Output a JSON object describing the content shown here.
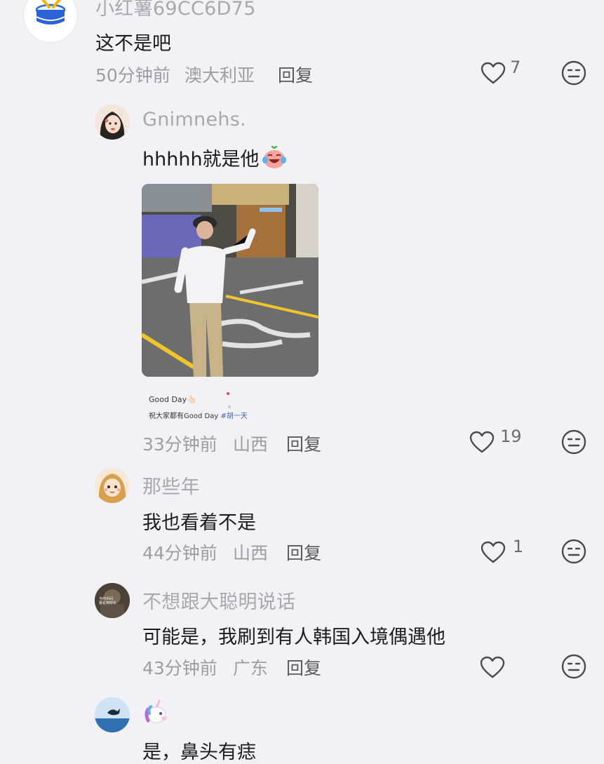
{
  "colors": {
    "background": "#f2f1f6",
    "meta_text": "#9d9da2",
    "name_text": "#a8a8ad",
    "hashtag": "#3c5fb1"
  },
  "comments": [
    {
      "username": "小红薯69CC6D75",
      "text": "这不是吧",
      "time": "50分钟前",
      "location": "澳大利亚",
      "reply_label": "回复",
      "likes": "7",
      "avatar_icon": "drum-avatar-icon"
    },
    {
      "username": "Gnimnehs.",
      "text": "hhhhh就是他",
      "emoji_icon": "laughing-tears-face-icon",
      "time": "33分钟前",
      "location": "山西",
      "reply_label": "回复",
      "likes": "19",
      "avatar_icon": "girl-portrait-avatar",
      "attachment": {
        "description_icon": "street-photo-man-in-bucket-hat",
        "caption_title": "Good Day👆🏻",
        "caption_body": "祝大家都有Good Day ",
        "caption_tag": "#胡一天"
      }
    },
    {
      "username": "那些年",
      "text": "我也看着不是",
      "time": "44分钟前",
      "location": "山西",
      "reply_label": "回复",
      "likes": "1",
      "avatar_icon": "cartoon-girl-avatar"
    },
    {
      "username": "不想跟大聪明说话",
      "text": "可能是，我刷到有人韩国入境偶遇他",
      "time": "43分钟前",
      "location": "广东",
      "reply_label": "回复",
      "likes": "",
      "avatar_icon": "dark-photo-avatar",
      "avatar_overlay_text": "当你中间\n被看到中午"
    },
    {
      "username": "🦄",
      "text": "是，鼻头有痣",
      "avatar_icon": "ocean-whale-avatar"
    }
  ]
}
